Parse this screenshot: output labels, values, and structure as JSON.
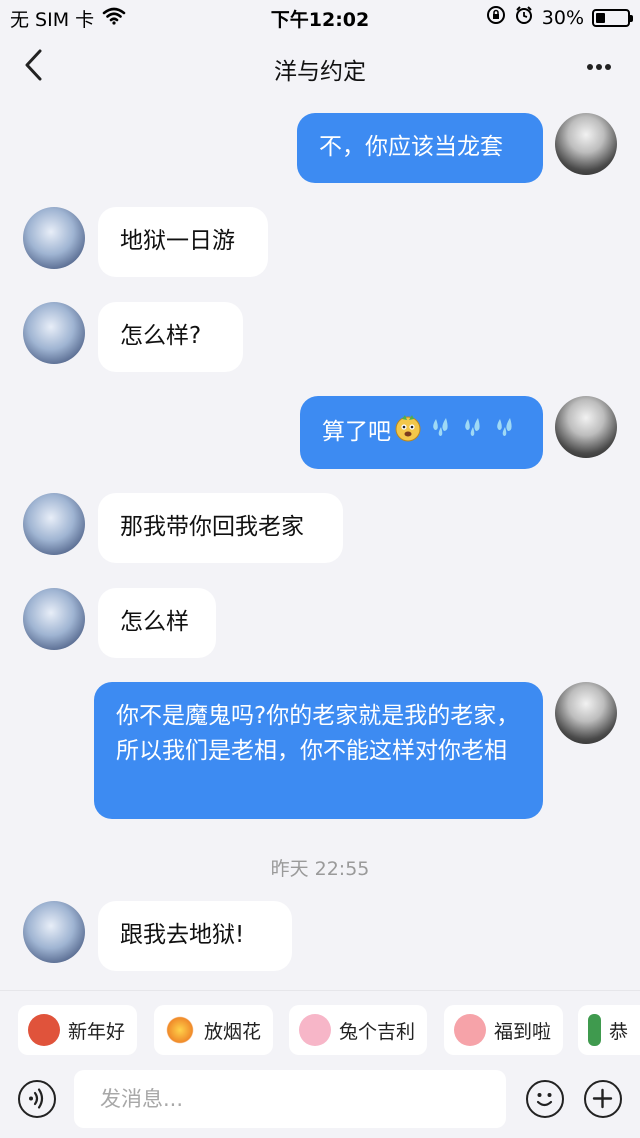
{
  "status_bar": {
    "carrier": "无 SIM 卡",
    "time": "下午12:02",
    "battery": "30%",
    "battery_level": 0.3
  },
  "header": {
    "title": "洋与约定"
  },
  "messages": [
    {
      "side": "right",
      "text": "不，你应该当龙套"
    },
    {
      "side": "left",
      "text": "地狱一日游"
    },
    {
      "side": "left",
      "text": "怎么样?"
    },
    {
      "side": "right",
      "text": "算了吧",
      "emojis": [
        "doge-emoji",
        "sweat-drop-emoji",
        "sweat-drop-emoji",
        "sweat-drop-emoji"
      ]
    },
    {
      "side": "left",
      "text": "那我带你回我老家"
    },
    {
      "side": "left",
      "text": "怎么样"
    },
    {
      "side": "right",
      "text": "你不是魔鬼吗?你的老家就是我的老家，所以我们是老相，你不能这样对你老相"
    },
    {
      "side": "left",
      "text": "跟我去地狱!"
    }
  ],
  "timestamp": "昨天 22:55",
  "quick_replies": [
    {
      "label": "新年好",
      "icon": "monkey-icon"
    },
    {
      "label": "放烟花",
      "icon": "firework-icon"
    },
    {
      "label": "兔个吉利",
      "icon": "rabbit-icon"
    },
    {
      "label": "福到啦",
      "icon": "piggy-icon"
    },
    {
      "label": "恭",
      "icon": "mahjong-icon"
    }
  ],
  "input": {
    "placeholder": "发消息..."
  },
  "colors": {
    "accent": "#3d8bf2",
    "background": "#f3f3f7"
  }
}
